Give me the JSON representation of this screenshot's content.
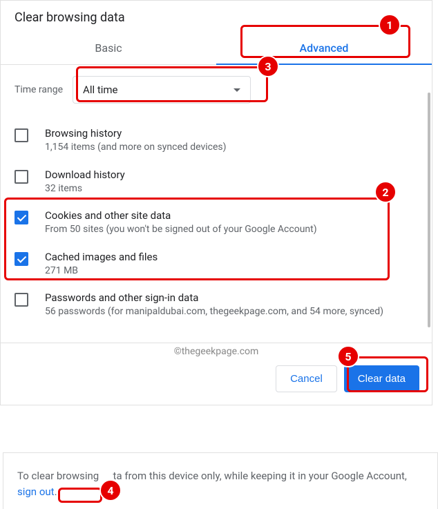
{
  "title": "Clear browsing data",
  "tabs": {
    "basic": "Basic",
    "advanced": "Advanced"
  },
  "time": {
    "label": "Time range",
    "value": "All time"
  },
  "items": [
    {
      "title": "Browsing history",
      "desc": "1,154 items (and more on synced devices)",
      "checked": false
    },
    {
      "title": "Download history",
      "desc": "32 items",
      "checked": false
    },
    {
      "title": "Cookies and other site data",
      "desc": "From 50 sites (you won't be signed out of your Google Account)",
      "checked": true
    },
    {
      "title": "Cached images and files",
      "desc": "271 MB",
      "checked": true
    },
    {
      "title": "Passwords and other sign-in data",
      "desc": "56 passwords (for manipaldubai.com, thegeekpage.com, and 54 more, synced)",
      "checked": false
    }
  ],
  "watermark": "©thegeekpage.com",
  "actions": {
    "cancel": "Cancel",
    "clear": "Clear data"
  },
  "footer": {
    "pre": "To clear browsing ",
    "mid": "ta from this device only, while keeping it in your Google Account,",
    "link": "sign out",
    "post": "."
  },
  "anno": {
    "b1": "1",
    "b2": "2",
    "b3": "3",
    "b4": "4",
    "b5": "5"
  }
}
